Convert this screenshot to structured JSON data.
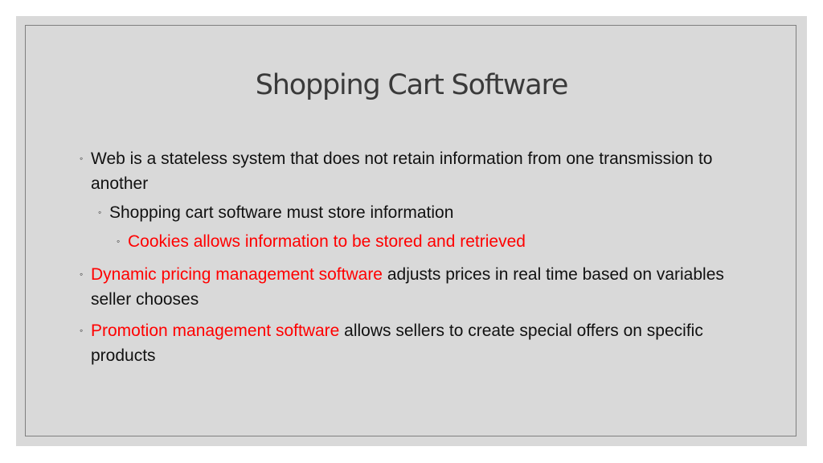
{
  "slide": {
    "title": "Shopping Cart Software",
    "bullet_glyph": "◦",
    "colors": {
      "background": "#d9d9d9",
      "frame": "#7f7f7f",
      "title": "#3a3a3a",
      "text": "#111111",
      "highlight": "#ff0000"
    },
    "bullets": [
      {
        "level": 1,
        "segments": [
          {
            "text": "Web is a stateless system that does not retain information from one transmission to another",
            "highlight": false
          }
        ]
      },
      {
        "level": 2,
        "segments": [
          {
            "text": "Shopping cart software must store information",
            "highlight": false
          }
        ]
      },
      {
        "level": 3,
        "segments": [
          {
            "text": "Cookies allows information to be stored and retrieved",
            "highlight": true
          }
        ]
      },
      {
        "level": 1,
        "segments": [
          {
            "text": "Dynamic pricing management software",
            "highlight": true
          },
          {
            "text": " adjusts prices in real time based on variables seller chooses",
            "highlight": false
          }
        ]
      },
      {
        "level": 1,
        "segments": [
          {
            "text": "Promotion management software",
            "highlight": true
          },
          {
            "text": " allows sellers to create special offers on specific products",
            "highlight": false
          }
        ]
      }
    ]
  }
}
